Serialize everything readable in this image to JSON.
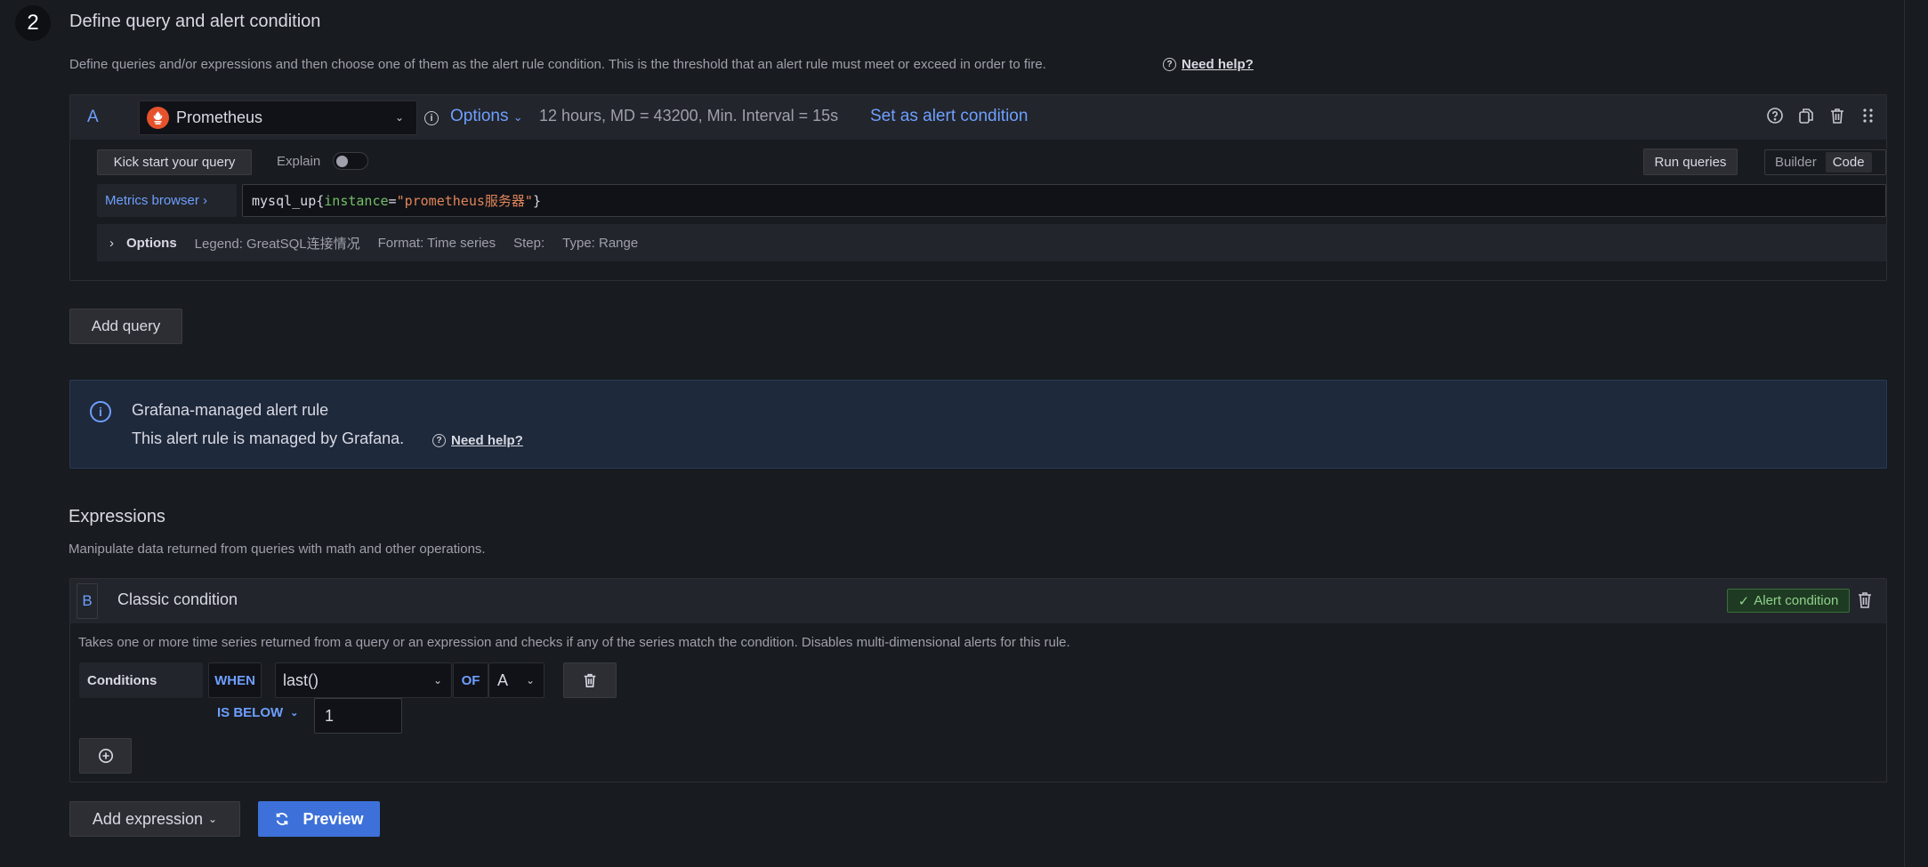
{
  "step": {
    "number": "2",
    "title": "Define query and alert condition",
    "description": "Define queries and/or expressions and then choose one of them as the alert rule condition. This is the threshold that an alert rule must meet or exceed in order to fire.",
    "help_link": "Need help?"
  },
  "query": {
    "ref_id": "A",
    "datasource": "Prometheus",
    "datasource_icon": "prometheus-logo",
    "options_label": "Options",
    "options_meta": "12 hours, MD = 43200, Min. Interval = 15s",
    "set_alert_label": "Set as alert condition",
    "header_icons": [
      "help-icon",
      "duplicate-icon",
      "trash-icon",
      "drag-handle-icon"
    ],
    "kick_start_label": "Kick start your query",
    "explain_label": "Explain",
    "explain_enabled": false,
    "run_queries_label": "Run queries",
    "modes": [
      {
        "label": "Builder",
        "active": false
      },
      {
        "label": "Code",
        "active": true
      }
    ],
    "metrics_browser_label": "Metrics browser ›",
    "expr": {
      "metric": "mysql_up",
      "open_brace": "{",
      "label_name": "instance",
      "operator": "=",
      "label_value": "\"prometheus服务器\"",
      "close_brace": "}"
    },
    "options_row": {
      "title": "Options",
      "legend": "Legend: GreatSQL连接情况",
      "format": "Format: Time series",
      "step": "Step:",
      "type": "Type: Range"
    }
  },
  "add_query_label": "Add query",
  "info_box": {
    "title": "Grafana-managed alert rule",
    "body": "This alert rule is managed by Grafana.",
    "help_link": "Need help?"
  },
  "expressions": {
    "title": "Expressions",
    "description": "Manipulate data returned from queries with math and other operations.",
    "items": [
      {
        "ref_id": "B",
        "name": "Classic condition",
        "badge": "Alert condition",
        "description": "Takes one or more time series returned from a query or an expression and checks if any of the series match the condition. Disables multi-dimensional alerts for this rule.",
        "conditions_label": "Conditions",
        "when_label": "WHEN",
        "reducer": "last()",
        "of_label": "OF",
        "query_ref": "A",
        "evaluator": "IS BELOW",
        "threshold": "1"
      }
    ],
    "add_expression_label": "Add expression",
    "preview_label": "Preview"
  },
  "colors": {
    "accent": "#6e9fff",
    "primary_button": "#3d71d9",
    "success": "#8fd28a",
    "background": "#181b1f"
  }
}
